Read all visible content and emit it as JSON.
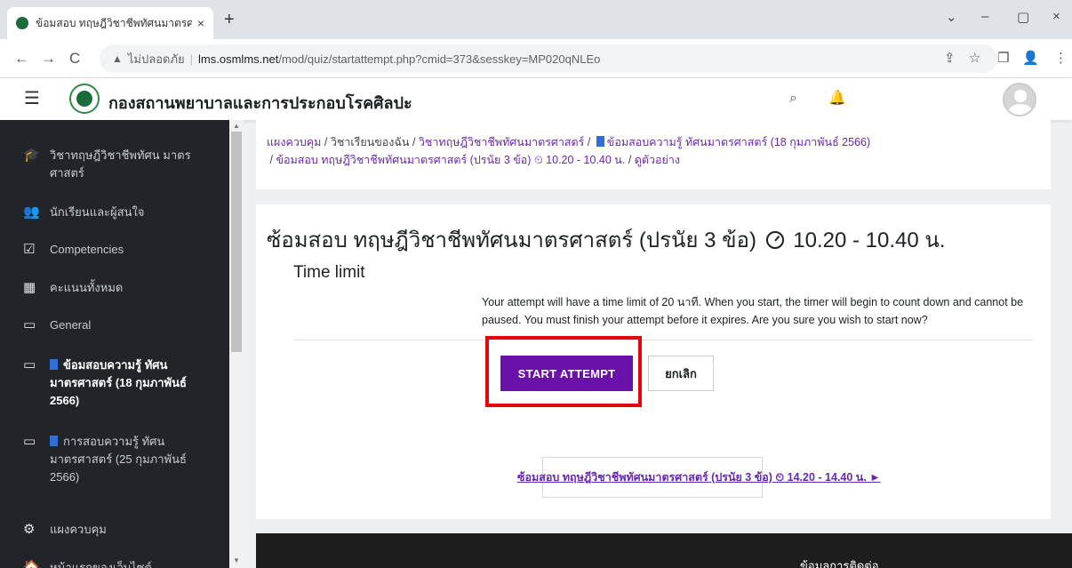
{
  "browser": {
    "tab_title": "ข้อมสอบ ทฤษฎีวิชาชีพทัศนมาตรศาสต...",
    "tab_close": "×",
    "new_tab": "+",
    "window_controls": [
      "⌄",
      "–",
      "▢",
      "×"
    ],
    "nav": [
      "←",
      "→",
      "C"
    ],
    "insecure_label": "ไม่ปลอดภัย",
    "url_host": "lms.osmlms.net",
    "url_path": "/mod/quiz/startattempt.php?cmid=373&sesskey=MP020qNLEo",
    "right_icons": [
      "⇪",
      "☆",
      "❐",
      "👤",
      "⋮"
    ]
  },
  "navbar": {
    "site_name": "กองสถานพยาบาลและการประกอบโรคศิลปะ",
    "menu_icon": "☰",
    "search_icon": "⌕",
    "bell_icon": "🔔"
  },
  "sidebar": {
    "items": [
      {
        "icon": "🎓",
        "label": "วิชาทฤษฎีวิชาชีพทัศน มาตรศาสตร์"
      },
      {
        "icon": "👥",
        "label": "นักเรียนและผู้สนใจ"
      },
      {
        "icon": "☑",
        "label": "Competencies"
      },
      {
        "icon": "▦",
        "label": "คะแนนทั้งหมด"
      },
      {
        "icon": "▭",
        "label": "General"
      },
      {
        "icon": "▭",
        "label": "ข้อมสอบความรู้ ทัศน มาตรศาสตร์ (18 กุมภาพันธ์ 2566)"
      },
      {
        "icon": "▭",
        "label": "การสอบความรู้ ทัศน มาตรศาสตร์ (25 กุมภาพันธ์ 2566)"
      },
      {
        "icon": "⚙",
        "label": "แผงควบคุม"
      },
      {
        "icon": "🏠",
        "label": "หน้าแรกของเว็บไซต์"
      }
    ]
  },
  "breadcrumb": {
    "dashboard": "แผงควบคุม",
    "my_courses": "วิชาเรียนของฉัน",
    "course": "วิชาทฤษฎีวิชาชีพทัศนมาตรศาสตร์",
    "section": "ข้อมสอบความรู้ ทัศนมาตรศาสตร์ (18 กุมภาพันธ์ 2566)",
    "quiz": "ข้อมสอบ ทฤษฎีวิชาชีพทัศนมาตรศาสตร์ (ปรนัย 3 ข้อ) ⏲ 10.20 - 10.40 น.",
    "current": "ดูตัวอย่าง",
    "sep": "/"
  },
  "main": {
    "title_text": "ซ้อมสอบ ทฤษฎีวิชาชีพทัศนมาตรศาสตร์ (ปรนัย 3 ข้อ)",
    "title_time": "10.20 - 10.40 น.",
    "time_limit_heading": "Time limit",
    "time_limit_text": "Your attempt will have a time limit of 20 นาที. When you start, the timer will begin to count down and cannot be paused. You must finish your attempt before it expires. Are you sure you wish to start now?",
    "start_button": "START ATTEMPT",
    "cancel_button": "ยกเลิก",
    "next_activity": "ซ้อมสอบ ทฤษฎีวิชาชีพทัศนมาตรศาสตร์ (ปรนัย 3 ข้อ) ⏲ 14.20 - 14.40 น. ►"
  },
  "footer": {
    "contact": "ข้อมูลการติดต่อ"
  }
}
